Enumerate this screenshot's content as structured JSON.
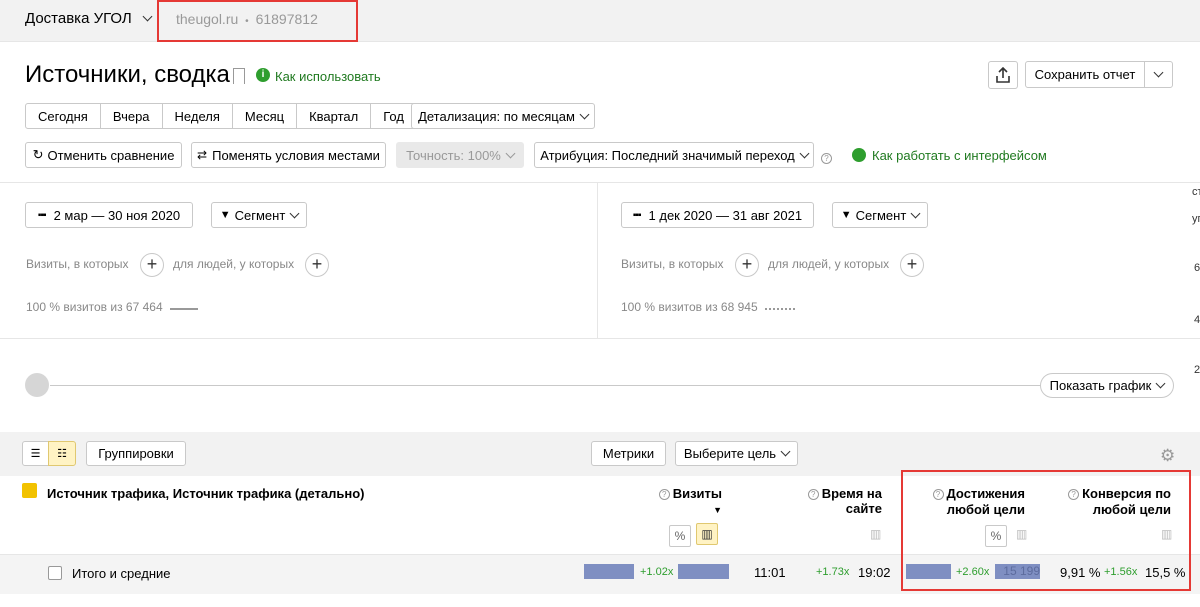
{
  "topbar": {
    "counter_name": "Доставка УГОЛ",
    "site": "theugol.ru",
    "separator": "•",
    "counter_id": "61897812"
  },
  "header": {
    "title": "Источники, сводка",
    "howto_link": "Как использовать",
    "save_report": "Сохранить отчет"
  },
  "periods": [
    "Сегодня",
    "Вчера",
    "Неделя",
    "Месяц",
    "Квартал",
    "Год"
  ],
  "detail": "Детализация: по месяцам",
  "controls": {
    "cancel_compare": "Отменить сравнение",
    "swap_conditions": "Поменять условия местами",
    "accuracy": "Точность: 100%",
    "attribution": "Атрибуция: Последний значимый переход",
    "interface_link": "Как работать с интерфейсом"
  },
  "segments": {
    "left": {
      "date_range": "2 мар — 30 ноя 2020",
      "segment": "Сегмент",
      "visits_label": "Визиты, в которых",
      "people_label": "для людей, у которых",
      "summary": "100 % визитов из 67 464"
    },
    "right": {
      "date_range": "1 дек 2020 — 31 авг 2021",
      "segment": "Сегмент",
      "visits_label": "Визиты, в которых",
      "people_label": "для людей, у которых",
      "summary": "100 % визитов из 68 945"
    }
  },
  "chart_toggle": "Показать график",
  "table": {
    "groupings": "Группировки",
    "metrics": "Метрики",
    "goal_select": "Выберите цель",
    "dimension_header": "Источник трафика, Источник трафика (детально)",
    "col_visits": "Визиты",
    "col_visits_sort": "▼",
    "col_time": "Время на сайте",
    "col_goal_line1": "Достижения",
    "col_goal_line2": "любой цели",
    "col_conv_line1": "Конверсия по",
    "col_conv_line2": "любой цели",
    "total_label": "Итого и средние",
    "totals": {
      "visits_delta": "+1.02x",
      "time_a": "11:01",
      "time_delta": "+1.73x",
      "time_b": "19:02",
      "goal_delta": "+2.60x",
      "goal_value": "15 199",
      "conv_a": "9,91 %",
      "conv_delta": "+1.56x",
      "conv_b": "15,5 %"
    }
  },
  "right_edge": [
    "ст",
    "уг",
    "6",
    "4",
    "2"
  ],
  "icons": {
    "share": "share-icon",
    "bookmark": "bookmark-icon",
    "settings": "gear-icon"
  },
  "colors": {
    "link_green": "#207a20",
    "highlight_red": "#e53935",
    "bar_blue": "#7f8fc2",
    "delta_green": "#2e9e2e"
  }
}
